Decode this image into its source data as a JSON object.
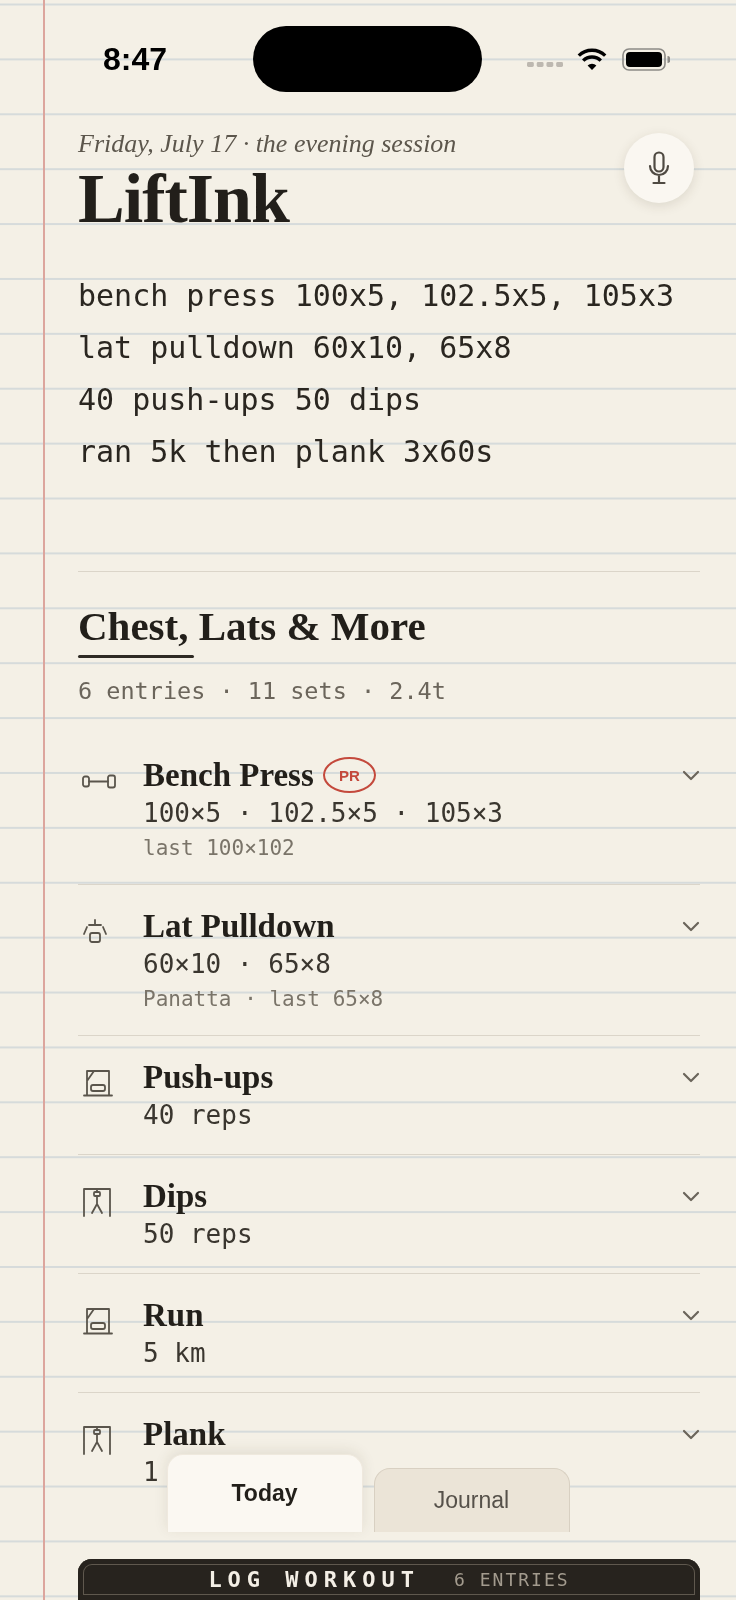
{
  "status_bar": {
    "time": "8:47"
  },
  "header": {
    "date": "Friday, July 17 · the evening session",
    "title": "LiftInk"
  },
  "notes_field": {
    "lines": [
      "bench press 100x5, 102.5x5, 105x3",
      "lat pulldown 60x10, 65x8",
      "40 push-ups 50 dips",
      "ran 5k then plank 3x60s"
    ]
  },
  "session": {
    "title": "Chest, Lats & More",
    "summary": "6 entries · 11 sets · 2.4t"
  },
  "exercises": [
    {
      "name": "Bench Press",
      "kind": "barbell",
      "badge": "PR",
      "sets": "100×5 · 102.5×5 · 105×3",
      "meta": "last 100×102",
      "expanded": false
    },
    {
      "name": "Lat Pulldown",
      "kind": "pulldown",
      "sets": "60×10 · 65×8",
      "meta": "Panatta · last 65×8",
      "expanded": false
    },
    {
      "name": "Push-ups",
      "kind": "station",
      "sets": "40 reps",
      "expanded": false
    },
    {
      "name": "Dips",
      "kind": "frame",
      "sets": "50 reps",
      "expanded": false
    },
    {
      "name": "Run",
      "kind": "station",
      "sets": "5 km",
      "expanded": false
    },
    {
      "name": "Plank",
      "kind": "frame",
      "sets": "1",
      "expanded": false
    }
  ],
  "tabs": [
    {
      "label": "Today",
      "selected": true
    },
    {
      "label": "Journal",
      "selected": false
    }
  ],
  "log_button": {
    "label": "LOG WORKOUT",
    "count": "6 ENTRIES"
  }
}
